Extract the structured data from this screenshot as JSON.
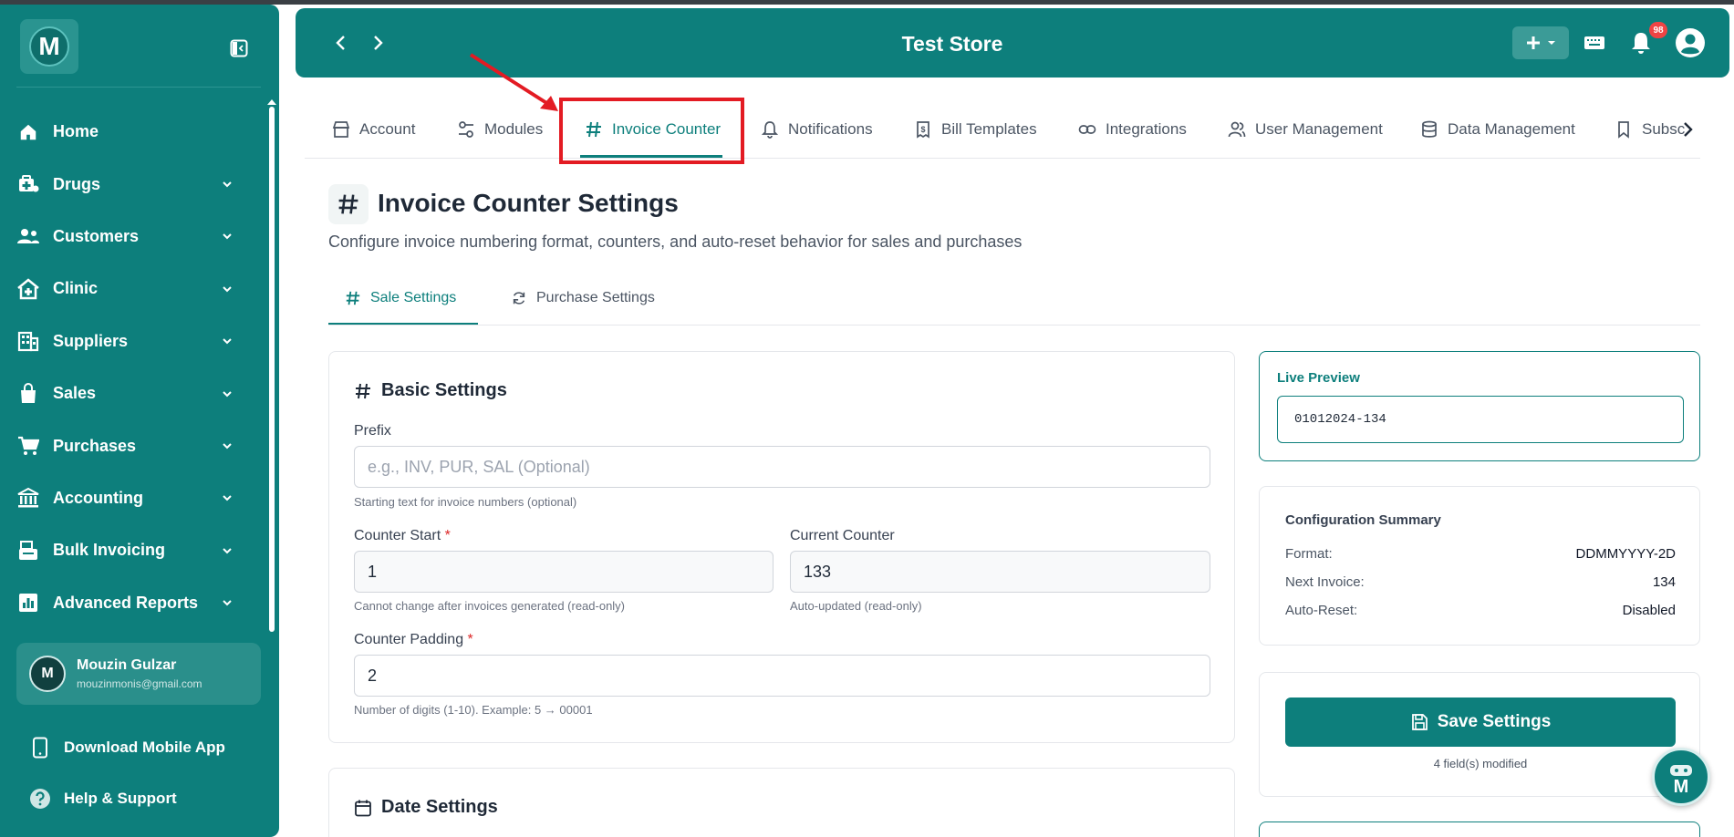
{
  "app": {
    "logo_letter": "M",
    "store_name": "Test Store",
    "notification_count": "98",
    "accent_color": "#0d7f7c"
  },
  "sidebar": {
    "items": [
      {
        "label": "Home",
        "icon": "home-icon"
      },
      {
        "label": "Drugs",
        "icon": "medkit-icon"
      },
      {
        "label": "Customers",
        "icon": "people-icon"
      },
      {
        "label": "Clinic",
        "icon": "clinic-icon"
      },
      {
        "label": "Suppliers",
        "icon": "building-icon"
      },
      {
        "label": "Sales",
        "icon": "bag-icon"
      },
      {
        "label": "Purchases",
        "icon": "cart-icon"
      },
      {
        "label": "Accounting",
        "icon": "bank-icon"
      },
      {
        "label": "Bulk Invoicing",
        "icon": "invoice-icon"
      },
      {
        "label": "Advanced Reports",
        "icon": "chart-icon"
      }
    ],
    "user": {
      "initial": "M",
      "name": "Mouzin Gulzar",
      "email": "mouzinmonis@gmail.com"
    },
    "bottom": [
      {
        "label": "Download Mobile App",
        "icon": "phone-icon"
      },
      {
        "label": "Help & Support",
        "icon": "help-icon"
      }
    ]
  },
  "tabs": [
    {
      "label": "Account",
      "icon": "store-icon"
    },
    {
      "label": "Modules",
      "icon": "toggles-icon"
    },
    {
      "label": "Invoice Counter",
      "icon": "hash-icon",
      "active": true
    },
    {
      "label": "Notifications",
      "icon": "bell-icon"
    },
    {
      "label": "Bill Templates",
      "icon": "receipt-icon"
    },
    {
      "label": "Integrations",
      "icon": "link-icon"
    },
    {
      "label": "User Management",
      "icon": "users-icon"
    },
    {
      "label": "Data Management",
      "icon": "database-icon"
    },
    {
      "label": "Subsc",
      "icon": "bookmark-icon"
    }
  ],
  "page": {
    "title": "Invoice Counter Settings",
    "subtitle": "Configure invoice numbering format, counters, and auto-reset behavior for sales and purchases"
  },
  "subtabs": [
    {
      "label": "Sale Settings",
      "active": true
    },
    {
      "label": "Purchase Settings"
    }
  ],
  "basic": {
    "title": "Basic Settings",
    "prefix_label": "Prefix",
    "prefix_placeholder": "e.g., INV, PUR, SAL (Optional)",
    "prefix_help": "Starting text for invoice numbers (optional)",
    "counter_start_label": "Counter Start",
    "counter_start_value": "1",
    "counter_start_help": "Cannot change after invoices generated (read-only)",
    "current_counter_label": "Current Counter",
    "current_counter_value": "133",
    "current_counter_help": "Auto-updated (read-only)",
    "padding_label": "Counter Padding",
    "padding_value": "2",
    "padding_help": "Number of digits (1-10). Example: 5 → 00001",
    "required_mark": "*"
  },
  "date_settings": {
    "title": "Date Settings"
  },
  "preview": {
    "title": "Live Preview",
    "value": "01012024-134"
  },
  "summary": {
    "title": "Configuration Summary",
    "rows": [
      {
        "key": "Format:",
        "value": "DDMMYYYY-2D"
      },
      {
        "key": "Next Invoice:",
        "value": "134"
      },
      {
        "key": "Auto-Reset:",
        "value": "Disabled"
      }
    ]
  },
  "save": {
    "label": "Save Settings",
    "note": "4 field(s) modified"
  }
}
